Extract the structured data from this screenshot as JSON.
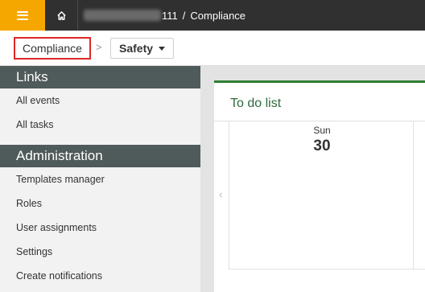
{
  "topbar": {
    "tenant_suffix": "111",
    "separator": "/",
    "app_name": "Compliance"
  },
  "breadcrumb": {
    "root_label": "Compliance",
    "selected_label": "Safety"
  },
  "sidebar": {
    "links_title": "Links",
    "links": [
      {
        "label": "All events"
      },
      {
        "label": "All tasks"
      }
    ],
    "admin_title": "Administration",
    "admin_items": [
      {
        "label": "Templates manager"
      },
      {
        "label": "Roles"
      },
      {
        "label": "User assignments"
      },
      {
        "label": "Settings"
      },
      {
        "label": "Create notifications"
      }
    ]
  },
  "todo": {
    "title": "To do list",
    "day_name": "Sun",
    "day_number": "30",
    "prev_icon": "‹"
  }
}
